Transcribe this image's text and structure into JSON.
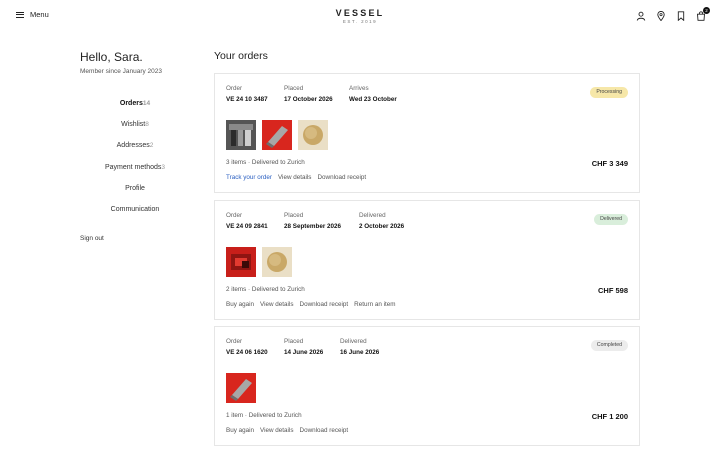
{
  "header": {
    "menu_label": "Menu",
    "brand_name": "VESSEL",
    "brand_tagline": "EST. 2019",
    "cart_count": "2"
  },
  "account": {
    "greeting": "Hello, Sara.",
    "member_since": "Member since January 2023",
    "nav": [
      {
        "label": "Orders",
        "count": "14",
        "active": true
      },
      {
        "label": "Wishlist",
        "count": "8",
        "active": false
      },
      {
        "label": "Addresses",
        "count": "2",
        "active": false
      },
      {
        "label": "Payment methods",
        "count": "3",
        "active": false
      },
      {
        "label": "Profile",
        "count": "",
        "active": false
      },
      {
        "label": "Communication",
        "count": "",
        "active": false
      }
    ],
    "sign_out": "Sign out"
  },
  "orders": {
    "title": "Your orders",
    "list": [
      {
        "order_label": "Order",
        "order_number": "VE 24 10 3487",
        "placed_label": "Placed",
        "placed_date": "17 October 2026",
        "third_label": "Arrives",
        "third_date": "Wed 23 October",
        "status": "Processing",
        "status_color": "#f6e7a8",
        "products": [
          "grey-angled-vessel",
          "red-angled-vessel",
          "brass-round-plate"
        ],
        "summary": "3 items · Delivered to Zurich",
        "total": "CHF 3 349",
        "actions": [
          {
            "label": "Track your order",
            "primary": true
          },
          {
            "label": "View details",
            "primary": false
          },
          {
            "label": "Download receipt",
            "primary": false
          }
        ]
      },
      {
        "order_label": "Order",
        "order_number": "VE 24 09 2841",
        "placed_label": "Placed",
        "placed_date": "28 September 2026",
        "third_label": "Delivered",
        "third_date": "2 October 2026",
        "status": "Delivered",
        "status_color": "#d9eedb",
        "products": [
          "red-box-vessel",
          "brass-round-plate"
        ],
        "summary": "2 items · Delivered to Zurich",
        "total": "CHF 598",
        "actions": [
          {
            "label": "Buy again",
            "primary": false
          },
          {
            "label": "View details",
            "primary": false
          },
          {
            "label": "Download receipt",
            "primary": false
          },
          {
            "label": "Return an item",
            "primary": false
          }
        ]
      },
      {
        "order_label": "Order",
        "order_number": "VE 24 06 1620",
        "placed_label": "Placed",
        "placed_date": "14 June 2026",
        "third_label": "Delivered",
        "third_date": "16 June 2026",
        "status": "Completed",
        "status_color": "#ececec",
        "products": [
          "red-angled-vessel"
        ],
        "summary": "1 item · Delivered to Zurich",
        "total": "CHF 1 200",
        "actions": [
          {
            "label": "Buy again",
            "primary": false
          },
          {
            "label": "View details",
            "primary": false
          },
          {
            "label": "Download receipt",
            "primary": false
          }
        ]
      }
    ]
  }
}
